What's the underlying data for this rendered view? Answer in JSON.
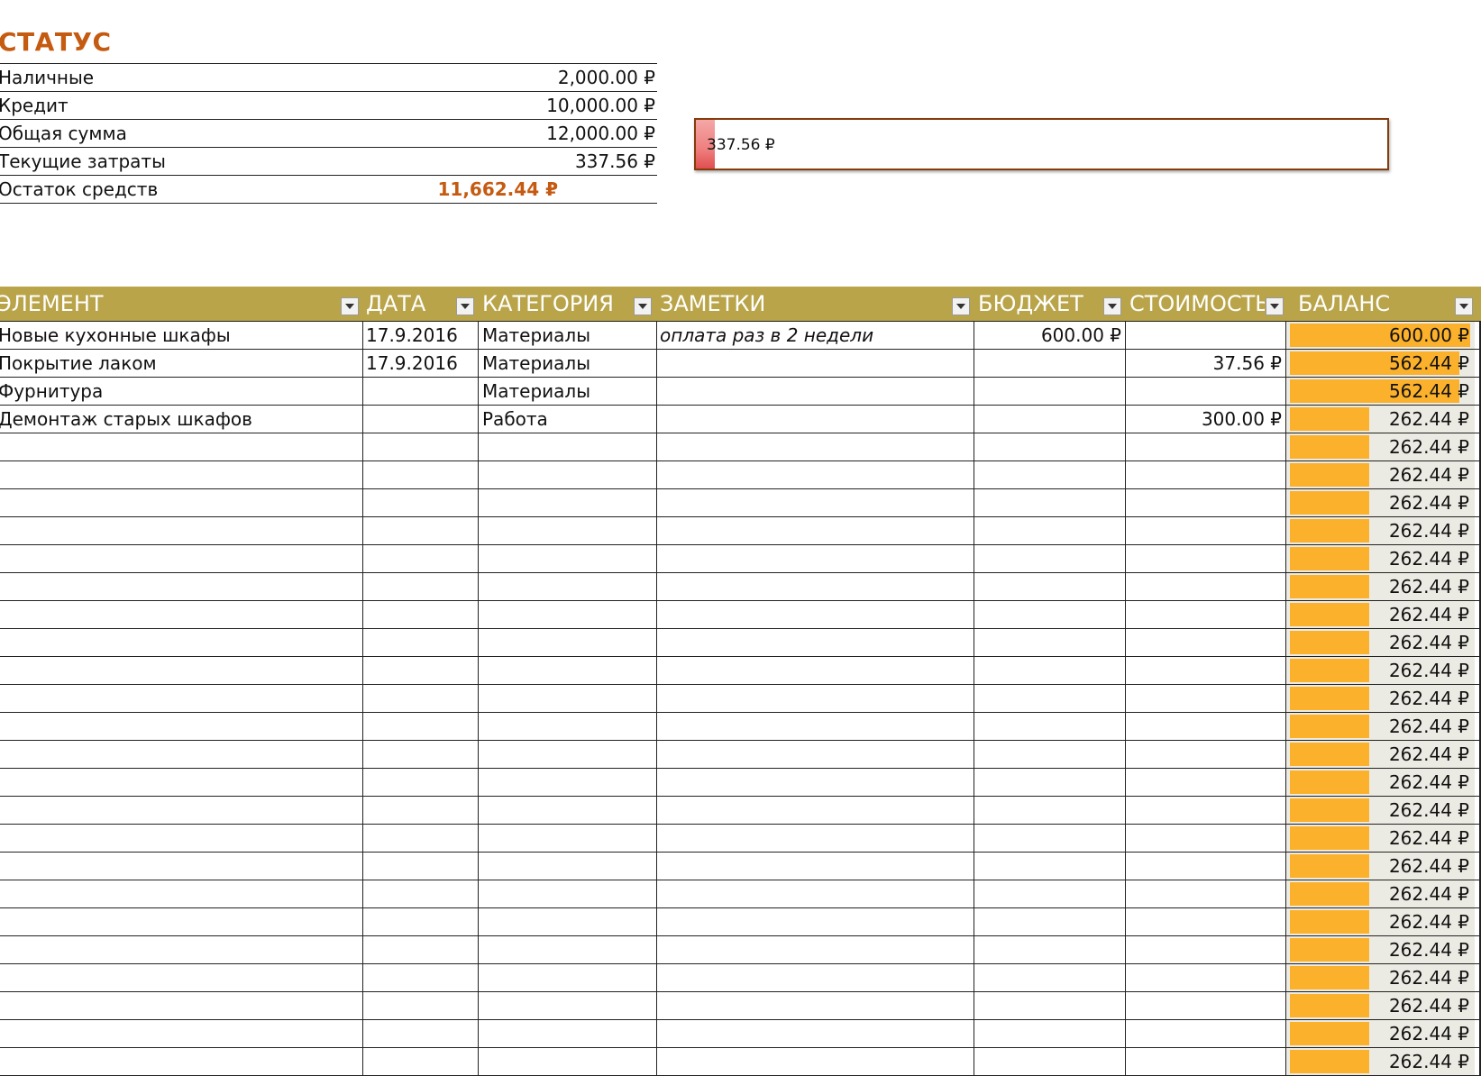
{
  "status": {
    "title": "СТАТУС",
    "rows": [
      {
        "label": "Наличные",
        "value": "2,000.00 ₽"
      },
      {
        "label": "Кредит",
        "value": "10,000.00 ₽"
      },
      {
        "label": "Общая сумма",
        "value": "12,000.00 ₽"
      },
      {
        "label": "Текущие затраты",
        "value": "337.56 ₽"
      },
      {
        "label": "Остаток средств",
        "value": "11,662.44 ₽"
      }
    ]
  },
  "progress": {
    "label": "337.56 ₽",
    "spent_fraction": 0.028
  },
  "table": {
    "columns": [
      "ЭЛЕМЕНТ",
      "ДАТА",
      "КАТЕГОРИЯ",
      "ЗАМЕТКИ",
      "БЮДЖЕТ",
      "СТОИМОСТЬ",
      "БАЛАНС"
    ],
    "rows": [
      {
        "item": "Новые кухонные шкафы",
        "date": "17.9.2016",
        "category": "Материалы",
        "notes": "оплата раз в 2 недели",
        "budget": "600.00 ₽",
        "cost": "",
        "balance": "600.00 ₽",
        "bar": 1.0
      },
      {
        "item": "Покрытие лаком",
        "date": "17.9.2016",
        "category": "Материалы",
        "notes": "",
        "budget": "",
        "cost": "37.56 ₽",
        "balance": "562.44 ₽",
        "bar": 0.94
      },
      {
        "item": "Фурнитура",
        "date": "",
        "category": "Материалы",
        "notes": "",
        "budget": "",
        "cost": "",
        "balance": "562.44 ₽",
        "bar": 0.94
      },
      {
        "item": "Демонтаж старых шкафов",
        "date": "",
        "category": "Работа",
        "notes": "",
        "budget": "",
        "cost": "300.00 ₽",
        "balance": "262.44 ₽",
        "bar": 0.44
      },
      {
        "item": "",
        "date": "",
        "category": "",
        "notes": "",
        "budget": "",
        "cost": "",
        "balance": "262.44 ₽",
        "bar": 0.44
      },
      {
        "item": "",
        "date": "",
        "category": "",
        "notes": "",
        "budget": "",
        "cost": "",
        "balance": "262.44 ₽",
        "bar": 0.44
      },
      {
        "item": "",
        "date": "",
        "category": "",
        "notes": "",
        "budget": "",
        "cost": "",
        "balance": "262.44 ₽",
        "bar": 0.44
      },
      {
        "item": "",
        "date": "",
        "category": "",
        "notes": "",
        "budget": "",
        "cost": "",
        "balance": "262.44 ₽",
        "bar": 0.44
      },
      {
        "item": "",
        "date": "",
        "category": "",
        "notes": "",
        "budget": "",
        "cost": "",
        "balance": "262.44 ₽",
        "bar": 0.44
      },
      {
        "item": "",
        "date": "",
        "category": "",
        "notes": "",
        "budget": "",
        "cost": "",
        "balance": "262.44 ₽",
        "bar": 0.44
      },
      {
        "item": "",
        "date": "",
        "category": "",
        "notes": "",
        "budget": "",
        "cost": "",
        "balance": "262.44 ₽",
        "bar": 0.44
      },
      {
        "item": "",
        "date": "",
        "category": "",
        "notes": "",
        "budget": "",
        "cost": "",
        "balance": "262.44 ₽",
        "bar": 0.44
      },
      {
        "item": "",
        "date": "",
        "category": "",
        "notes": "",
        "budget": "",
        "cost": "",
        "balance": "262.44 ₽",
        "bar": 0.44
      },
      {
        "item": "",
        "date": "",
        "category": "",
        "notes": "",
        "budget": "",
        "cost": "",
        "balance": "262.44 ₽",
        "bar": 0.44
      },
      {
        "item": "",
        "date": "",
        "category": "",
        "notes": "",
        "budget": "",
        "cost": "",
        "balance": "262.44 ₽",
        "bar": 0.44
      },
      {
        "item": "",
        "date": "",
        "category": "",
        "notes": "",
        "budget": "",
        "cost": "",
        "balance": "262.44 ₽",
        "bar": 0.44
      },
      {
        "item": "",
        "date": "",
        "category": "",
        "notes": "",
        "budget": "",
        "cost": "",
        "balance": "262.44 ₽",
        "bar": 0.44
      },
      {
        "item": "",
        "date": "",
        "category": "",
        "notes": "",
        "budget": "",
        "cost": "",
        "balance": "262.44 ₽",
        "bar": 0.44
      },
      {
        "item": "",
        "date": "",
        "category": "",
        "notes": "",
        "budget": "",
        "cost": "",
        "balance": "262.44 ₽",
        "bar": 0.44
      },
      {
        "item": "",
        "date": "",
        "category": "",
        "notes": "",
        "budget": "",
        "cost": "",
        "balance": "262.44 ₽",
        "bar": 0.44
      },
      {
        "item": "",
        "date": "",
        "category": "",
        "notes": "",
        "budget": "",
        "cost": "",
        "balance": "262.44 ₽",
        "bar": 0.44
      },
      {
        "item": "",
        "date": "",
        "category": "",
        "notes": "",
        "budget": "",
        "cost": "",
        "balance": "262.44 ₽",
        "bar": 0.44
      },
      {
        "item": "",
        "date": "",
        "category": "",
        "notes": "",
        "budget": "",
        "cost": "",
        "balance": "262.44 ₽",
        "bar": 0.44
      },
      {
        "item": "",
        "date": "",
        "category": "",
        "notes": "",
        "budget": "",
        "cost": "",
        "balance": "262.44 ₽",
        "bar": 0.44
      },
      {
        "item": "",
        "date": "",
        "category": "",
        "notes": "",
        "budget": "",
        "cost": "",
        "balance": "262.44 ₽",
        "bar": 0.44
      },
      {
        "item": "",
        "date": "",
        "category": "",
        "notes": "",
        "budget": "",
        "cost": "",
        "balance": "262.44 ₽",
        "bar": 0.44
      },
      {
        "item": "",
        "date": "",
        "category": "",
        "notes": "",
        "budget": "",
        "cost": "",
        "balance": "262.44 ₽",
        "bar": 0.44
      }
    ]
  },
  "colors": {
    "accent": "#c55a11",
    "header_bg": "#b9a449",
    "progress_border": "#843c0c",
    "progress_fill": "#ef7f7f",
    "balance_bar": "#fbb12b",
    "balance_bg": "#ecebe3"
  }
}
